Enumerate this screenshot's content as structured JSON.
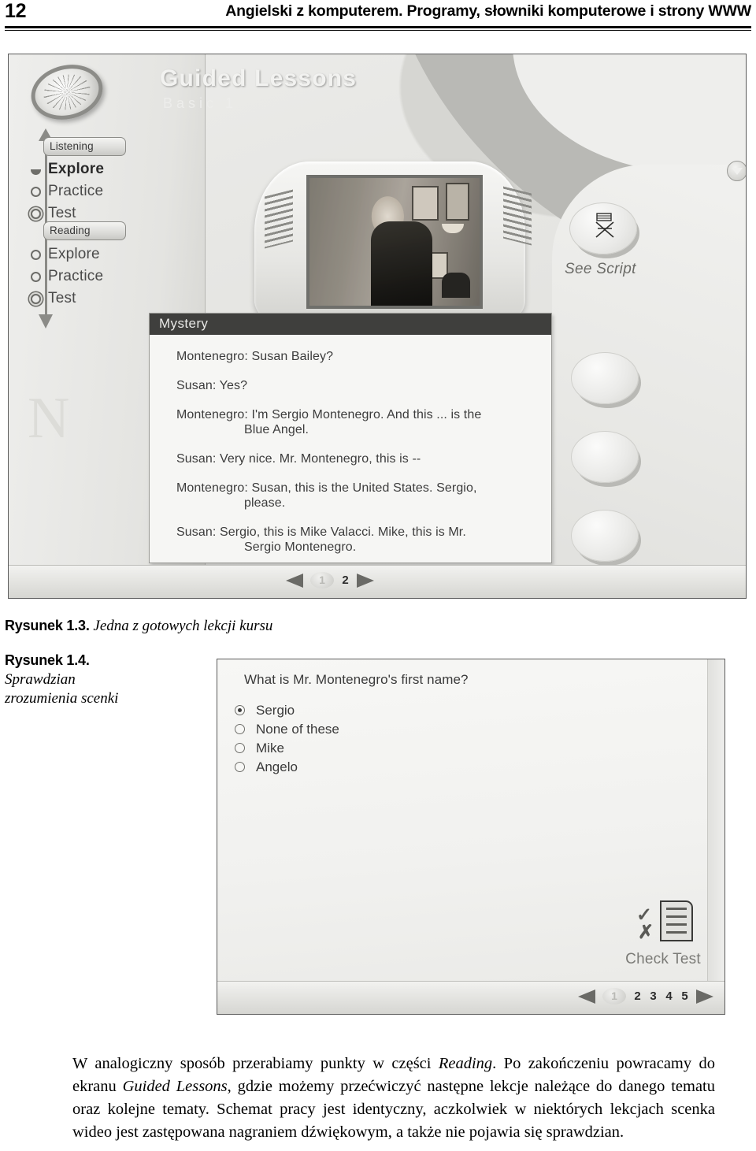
{
  "running_head": {
    "folio": "12",
    "title": "Angielski z komputerem. Programy, słowniki komputerowe i strony WWW"
  },
  "figure1": {
    "app": {
      "title": "Guided Lessons",
      "subtitle": "Basic 1"
    },
    "sidebar": {
      "sections": [
        {
          "pill": "Listening",
          "items": [
            {
              "label": "Explore",
              "state": "active"
            },
            {
              "label": "Practice",
              "state": "pending"
            },
            {
              "label": "Test",
              "state": "ring"
            }
          ]
        },
        {
          "pill": "Reading",
          "items": [
            {
              "label": "Explore",
              "state": "pending"
            },
            {
              "label": "Practice",
              "state": "pending"
            },
            {
              "label": "Test",
              "state": "ring"
            }
          ]
        }
      ],
      "watermark": "N",
      "compass_icon": "compass-icon"
    },
    "player": {
      "stop_icon": "stop-icon",
      "replay_icon": "replay-icon",
      "volume_slider_icon": "slider-icon"
    },
    "see_script": {
      "label": "See Script",
      "icon": "directors-chair-icon"
    },
    "dropdown_icon": "chevron-down-icon",
    "book_icon": "book-icon",
    "script": {
      "title": "Mystery",
      "lines": [
        {
          "text": "Montenegro: Susan Bailey?",
          "cont": ""
        },
        {
          "text": "Susan: Yes?",
          "cont": ""
        },
        {
          "text": "Montenegro: I'm Sergio Montenegro. And this ... is the",
          "cont": "Blue Angel."
        },
        {
          "text": "Susan: Very nice. Mr. Montenegro, this is --",
          "cont": ""
        },
        {
          "text": "Montenegro: Susan, this is the United States. Sergio,",
          "cont": "please."
        },
        {
          "text": "Susan: Sergio, this is Mike Valacci. Mike, this is Mr.",
          "cont": "Sergio Montenegro."
        }
      ]
    },
    "pager": {
      "prev_icon": "arrow-left-icon",
      "next_icon": "arrow-right-icon",
      "current": "1",
      "pages": [
        "2"
      ]
    }
  },
  "figure2": {
    "question": "What is Mr. Montenegro's first name?",
    "options": [
      {
        "label": "Sergio",
        "selected": true
      },
      {
        "label": "None of these",
        "selected": false
      },
      {
        "label": "Mike",
        "selected": false
      },
      {
        "label": "Angelo",
        "selected": false
      }
    ],
    "check_test": {
      "label": "Check Test",
      "check_icon": "check-mark-icon",
      "x_icon": "cross-mark-icon",
      "doc_icon": "document-icon"
    },
    "pager": {
      "prev_icon": "arrow-left-icon",
      "next_icon": "arrow-right-icon",
      "current": "1",
      "pages": [
        "2",
        "3",
        "4",
        "5"
      ]
    }
  },
  "captions": {
    "fig13_number": "Rysunek 1.3.",
    "fig13_text": "Jedna z gotowych lekcji kursu",
    "fig14_number": "Rysunek 1.4.",
    "fig14_line1": "Sprawdzian",
    "fig14_line2": "zrozumienia scenki"
  },
  "body": {
    "p1_a": "W analogiczny sposób przerabiamy punkty w części ",
    "p1_em1": "Reading",
    "p1_b": ". Po zakończeniu powracamy do ekranu ",
    "p1_em2": "Guided Lessons",
    "p1_c": ", gdzie możemy przećwiczyć następne lekcje należące do danego tematu oraz kolejne tematy. Schemat pracy jest identyczny, aczkolwiek w niektórych lekcjach scenka wideo jest zastępowana nagraniem dźwiękowym, a także nie pojawia się sprawdzian."
  }
}
